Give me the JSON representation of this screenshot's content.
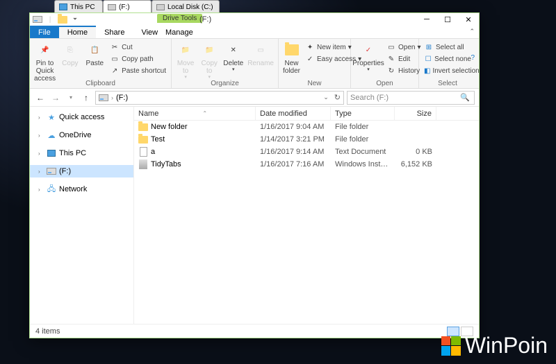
{
  "tabs": [
    {
      "label": "This PC"
    },
    {
      "label": "(F:)"
    },
    {
      "label": "Local Disk (C:)"
    }
  ],
  "titlebar": {
    "drive_tools": "Drive Tools",
    "title": "(F:)"
  },
  "ribbon_tabs": {
    "file": "File",
    "home": "Home",
    "share": "Share",
    "view": "View",
    "manage": "Manage"
  },
  "ribbon": {
    "clipboard": {
      "label": "Clipboard",
      "pin": "Pin to Quick access",
      "copy": "Copy",
      "paste": "Paste",
      "cut": "Cut",
      "copypath": "Copy path",
      "pasteshortcut": "Paste shortcut"
    },
    "organize": {
      "label": "Organize",
      "moveto": "Move to",
      "copyto": "Copy to",
      "delete": "Delete",
      "rename": "Rename"
    },
    "new": {
      "label": "New",
      "newfolder": "New folder",
      "newitem": "New item",
      "easyaccess": "Easy access"
    },
    "open": {
      "label": "Open",
      "properties": "Properties",
      "open": "Open",
      "edit": "Edit",
      "history": "History"
    },
    "select": {
      "label": "Select",
      "all": "Select all",
      "none": "Select none",
      "invert": "Invert selection"
    }
  },
  "address": {
    "path": "(F:)",
    "search_placeholder": "Search (F:)"
  },
  "columns": {
    "name": "Name",
    "date": "Date modified",
    "type": "Type",
    "size": "Size"
  },
  "nav": [
    {
      "label": "Quick access",
      "icon": "star"
    },
    {
      "label": "OneDrive",
      "icon": "cloud"
    },
    {
      "label": "This PC",
      "icon": "pc"
    },
    {
      "label": "(F:)",
      "icon": "drive",
      "selected": true
    },
    {
      "label": "Network",
      "icon": "net"
    }
  ],
  "files": [
    {
      "name": "New folder",
      "date": "1/16/2017 9:04 AM",
      "type": "File folder",
      "size": "",
      "icon": "folder"
    },
    {
      "name": "Test",
      "date": "1/14/2017 3:21 PM",
      "type": "File folder",
      "size": "",
      "icon": "folder"
    },
    {
      "name": "a",
      "date": "1/16/2017 9:14 AM",
      "type": "Text Document",
      "size": "0 KB",
      "icon": "txt"
    },
    {
      "name": "TidyTabs",
      "date": "1/16/2017 7:16 AM",
      "type": "Windows Installer ...",
      "size": "6,152 KB",
      "icon": "msi"
    }
  ],
  "status": {
    "count": "4 items"
  },
  "watermark": "WinPoin"
}
